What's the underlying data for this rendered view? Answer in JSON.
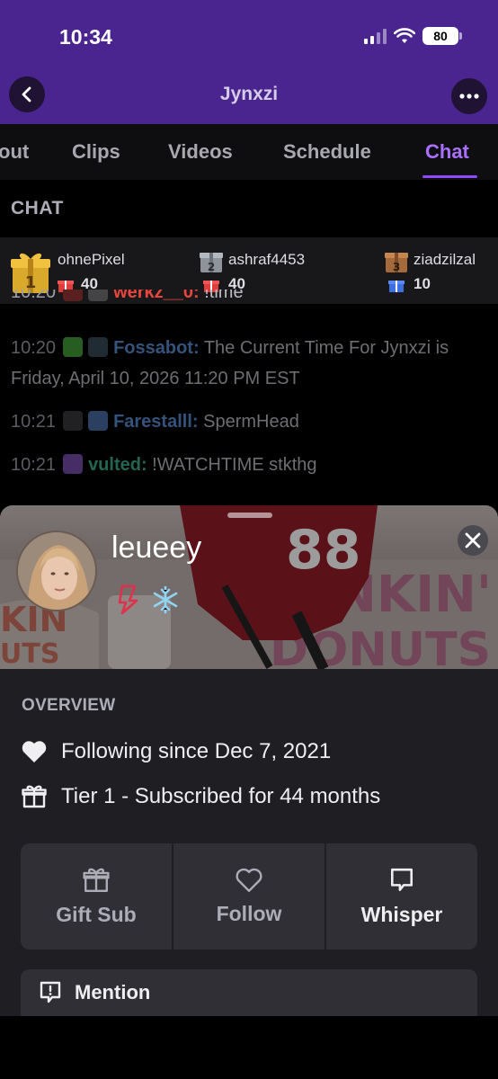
{
  "status_bar": {
    "time": "10:34",
    "battery": "80"
  },
  "header": {
    "title": "Jynxzi"
  },
  "tabs": [
    {
      "label": "About",
      "visible_text": "out"
    },
    {
      "label": "Clips"
    },
    {
      "label": "Videos"
    },
    {
      "label": "Schedule"
    },
    {
      "label": "Chat",
      "active": true
    }
  ],
  "chat": {
    "section_label": "CHAT",
    "gift_leaderboard": [
      {
        "rank": "1",
        "name": "ohnePixel",
        "count": "40"
      },
      {
        "rank": "2",
        "name": "ashraf4453",
        "count": "40"
      },
      {
        "rank": "3",
        "name": "ziadzilzal",
        "count": "10"
      }
    ],
    "messages": [
      {
        "time": "10:20",
        "user": "werkz__0:",
        "text": " !time",
        "user_color": "#e8453c"
      },
      {
        "time": "10:20",
        "user": "Fossabot:",
        "text": " The Current Time For Jynxzi is Friday, April 10, 2026 11:20 PM EST",
        "user_color": "#5b8fd6"
      },
      {
        "time": "10:21",
        "user": "Farestalll:",
        "text": " SpermHead",
        "user_color": "#5b8fd6"
      },
      {
        "time": "10:21",
        "user": "vulted:",
        "text": " !WATCHTIME stkthg",
        "user_color": "#3fae8c"
      }
    ]
  },
  "user_card": {
    "username": "leueey",
    "overview_label": "OVERVIEW",
    "following": "Following since Dec 7, 2021",
    "subscription": "Tier 1 - Subscribed for 44 months",
    "actions": [
      {
        "label": "Gift Sub",
        "icon": "gift-icon"
      },
      {
        "label": "Follow",
        "icon": "heart-outline-icon"
      },
      {
        "label": "Whisper",
        "icon": "chat-bubble-icon"
      }
    ],
    "mention_label": "Mention"
  },
  "colors": {
    "brand_purple": "#9147ff",
    "header_bg": "#4a2590"
  }
}
